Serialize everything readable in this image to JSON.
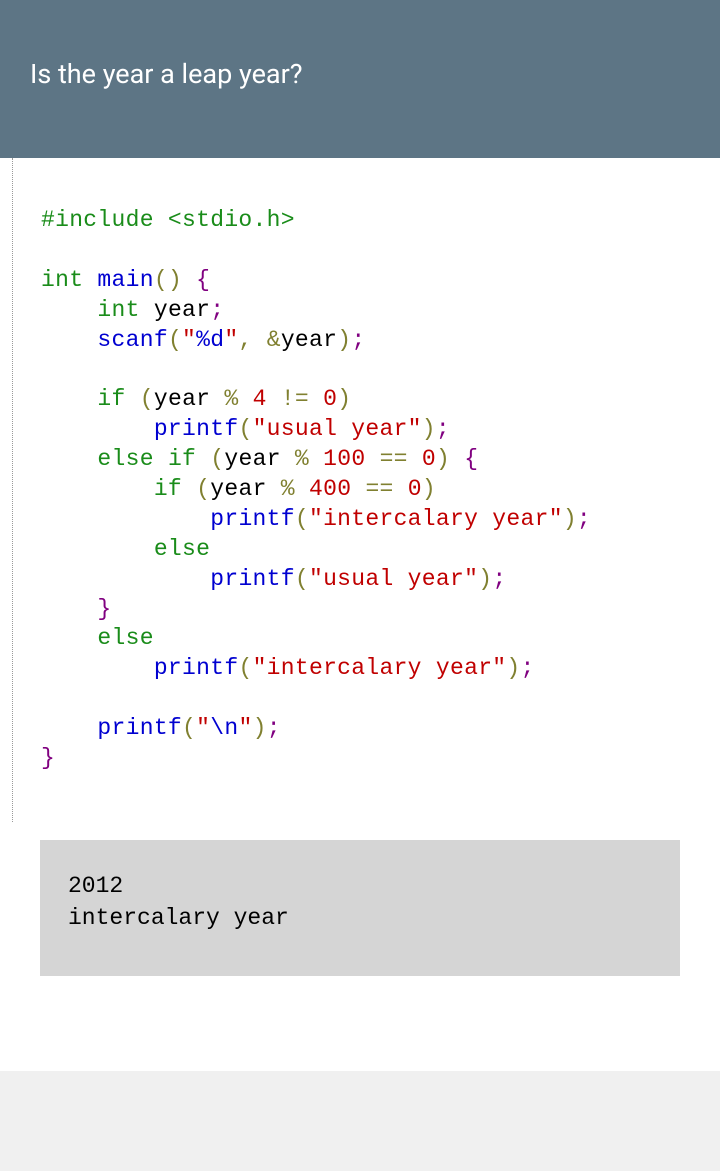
{
  "header": {
    "title": "Is the year a leap year?"
  },
  "code": {
    "include": "#include <stdio.h>",
    "int": "int",
    "main": "main",
    "year": "year",
    "scanf": "scanf",
    "printf": "printf",
    "if": "if",
    "else": "else",
    "fmt_d": "%d",
    "fmt_n": "\\n",
    "amp": "&",
    "n4": "4",
    "n100": "100",
    "n400": "400",
    "n0": "0",
    "usual": "\"usual year\"",
    "intercalary": "\"intercalary year\"",
    "percent": "%",
    "neq": "!=",
    "eqeq": "==",
    "comma": ",",
    "semi": ";",
    "lparen": "(",
    "rparen": ")",
    "lbrace": "{",
    "rbrace": "}"
  },
  "output": {
    "line1": "2012",
    "line2": "intercalary year"
  }
}
